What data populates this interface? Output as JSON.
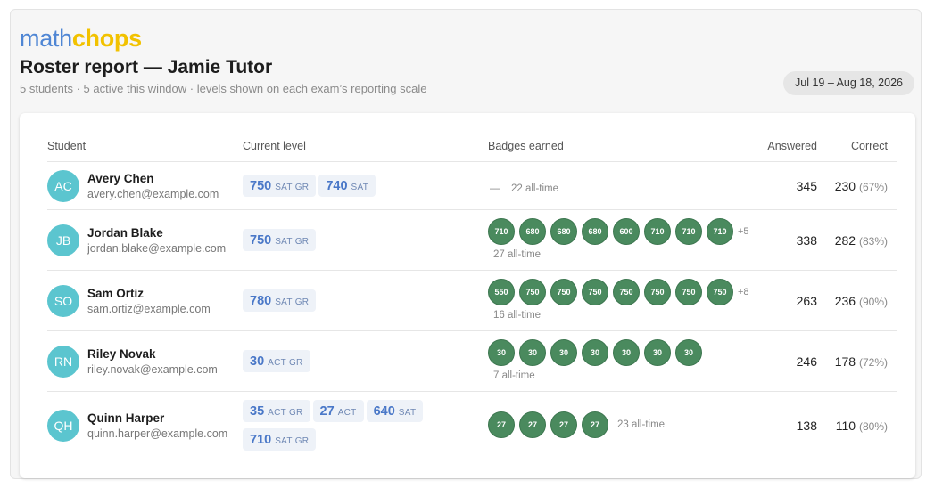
{
  "brand": {
    "part1": "math",
    "part2": "chops"
  },
  "header": {
    "title": "Roster report — Jamie Tutor",
    "subtitle": "5 students · 5 active this window · levels shown on each exam’s reporting scale",
    "date_range": "Jul 19 – Aug 18, 2026"
  },
  "table": {
    "headers": {
      "student": "Student",
      "level": "Current level",
      "badges": "Badges earned",
      "answered": "Answered",
      "correct": "Correct"
    }
  },
  "students": [
    {
      "initials": "AC",
      "name": "Avery Chen",
      "email": "avery.chen@example.com",
      "levels": [
        {
          "value": "750",
          "scale": "SAT GR"
        },
        {
          "value": "740",
          "scale": "SAT"
        }
      ],
      "badges": [],
      "badges_more": "",
      "badges_dash": "—",
      "all_time": "22 all-time",
      "answered": "345",
      "correct": "230",
      "correct_pct": "(67%)"
    },
    {
      "initials": "JB",
      "name": "Jordan Blake",
      "email": "jordan.blake@example.com",
      "levels": [
        {
          "value": "750",
          "scale": "SAT GR"
        }
      ],
      "badges": [
        "710",
        "680",
        "680",
        "680",
        "600",
        "710",
        "710",
        "710"
      ],
      "badges_more": "+5",
      "badges_dash": "",
      "all_time": "27 all-time",
      "answered": "338",
      "correct": "282",
      "correct_pct": "(83%)"
    },
    {
      "initials": "SO",
      "name": "Sam Ortiz",
      "email": "sam.ortiz@example.com",
      "levels": [
        {
          "value": "780",
          "scale": "SAT GR"
        }
      ],
      "badges": [
        "550",
        "750",
        "750",
        "750",
        "750",
        "750",
        "750",
        "750"
      ],
      "badges_more": "+8",
      "badges_dash": "",
      "all_time": "16 all-time",
      "answered": "263",
      "correct": "236",
      "correct_pct": "(90%)"
    },
    {
      "initials": "RN",
      "name": "Riley Novak",
      "email": "riley.novak@example.com",
      "levels": [
        {
          "value": "30",
          "scale": "ACT GR"
        }
      ],
      "badges": [
        "30",
        "30",
        "30",
        "30",
        "30",
        "30",
        "30"
      ],
      "badges_more": "",
      "badges_dash": "",
      "all_time": "7 all-time",
      "answered": "246",
      "correct": "178",
      "correct_pct": "(72%)"
    },
    {
      "initials": "QH",
      "name": "Quinn Harper",
      "email": "quinn.harper@example.com",
      "levels": [
        {
          "value": "35",
          "scale": "ACT GR"
        },
        {
          "value": "27",
          "scale": "ACT"
        },
        {
          "value": "640",
          "scale": "SAT"
        },
        {
          "value": "710",
          "scale": "SAT GR"
        }
      ],
      "badges": [
        "27",
        "27",
        "27",
        "27"
      ],
      "badges_more": "",
      "badges_dash": "",
      "all_time": "23 all-time",
      "answered": "138",
      "correct": "110",
      "correct_pct": "(80%)"
    }
  ],
  "colors": {
    "brand_blue": "#4f86d4",
    "brand_yellow": "#f2c200",
    "avatar": "#5bc5cf",
    "badge_green": "#4a8a5e",
    "level_blue": "#4a78c8"
  }
}
